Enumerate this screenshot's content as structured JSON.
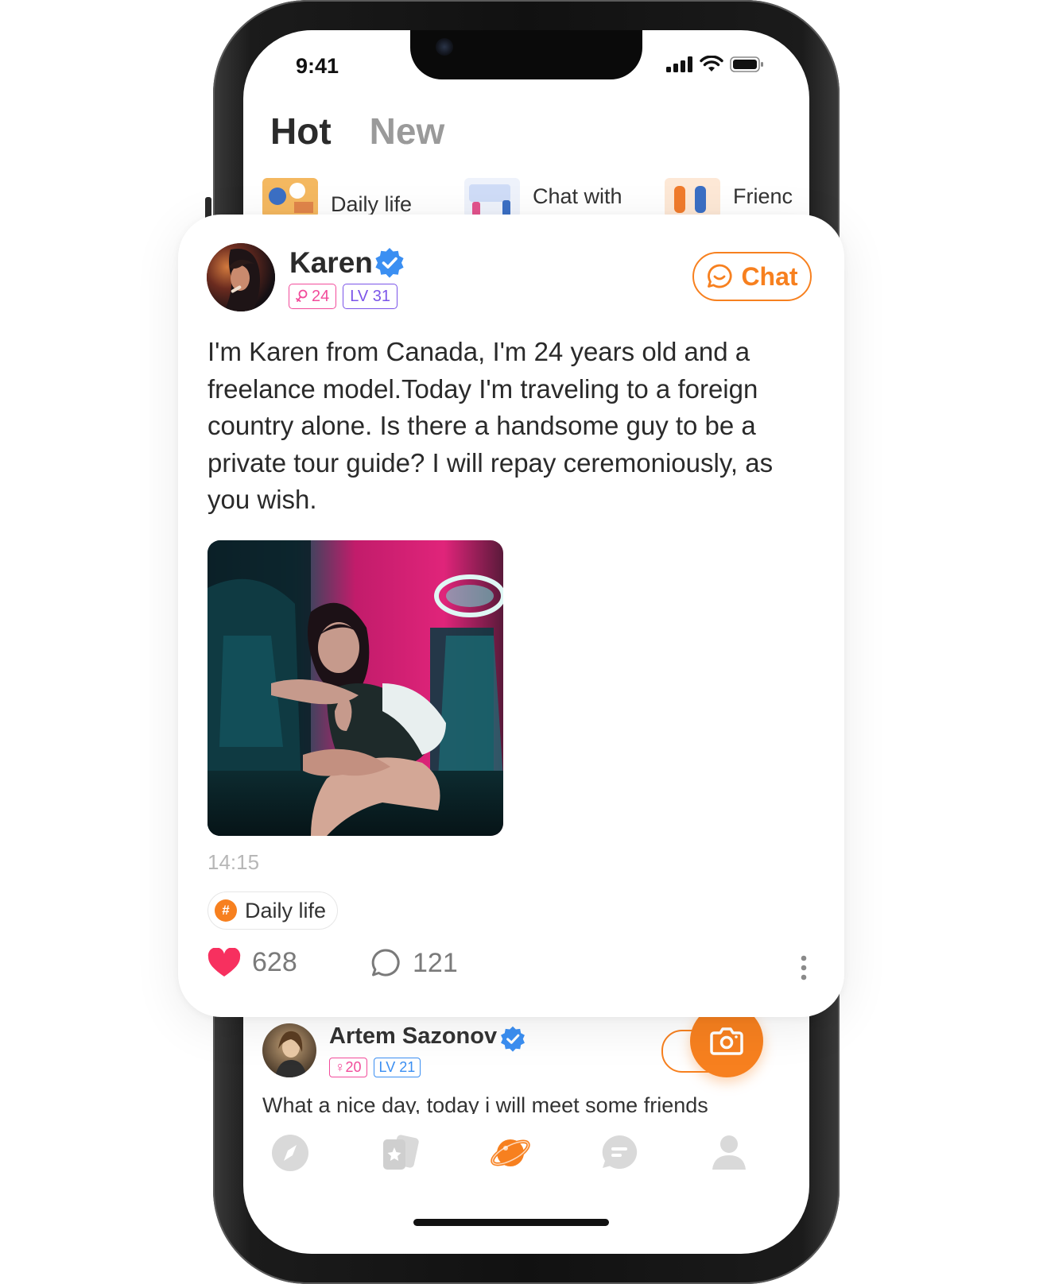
{
  "status_bar": {
    "time": "9:41"
  },
  "feed_tabs": [
    {
      "label": "Hot",
      "active": true
    },
    {
      "label": "New",
      "active": false
    }
  ],
  "topics": [
    {
      "label": "Daily life"
    },
    {
      "label": "Chat with"
    },
    {
      "label": "Frienc"
    }
  ],
  "post": {
    "author": "Karen",
    "verified": true,
    "age": "24",
    "level": "LV 31",
    "chat_label": "Chat",
    "text": "I'm Karen from Canada, I'm 24 years old and a freelance model.Today I'm traveling to a foreign country alone. Is there a handsome guy to be a private tour guide? I will repay ceremoniously, as you wish.",
    "time": "14:15",
    "topic": "Daily life",
    "likes": "628",
    "comments": "121"
  },
  "next_post": {
    "author": "Artem Sazonov",
    "verified": true,
    "age": "20",
    "level": "LV 21",
    "text": "What a nice day, today i will meet some friends"
  },
  "tab_bar": {
    "items": [
      {
        "icon": "compass-icon",
        "active": false
      },
      {
        "icon": "cards-icon",
        "active": false
      },
      {
        "icon": "planet-icon",
        "active": true
      },
      {
        "icon": "message-icon",
        "active": false
      },
      {
        "icon": "profile-icon",
        "active": false
      }
    ]
  },
  "colors": {
    "accent": "#f7801f",
    "verified": "#3b8ff2",
    "like": "#f7305f",
    "female_badge": "#f24c9b",
    "level_badge_primary": "#7b54e8",
    "level_badge_secondary": "#3b8ff2"
  }
}
